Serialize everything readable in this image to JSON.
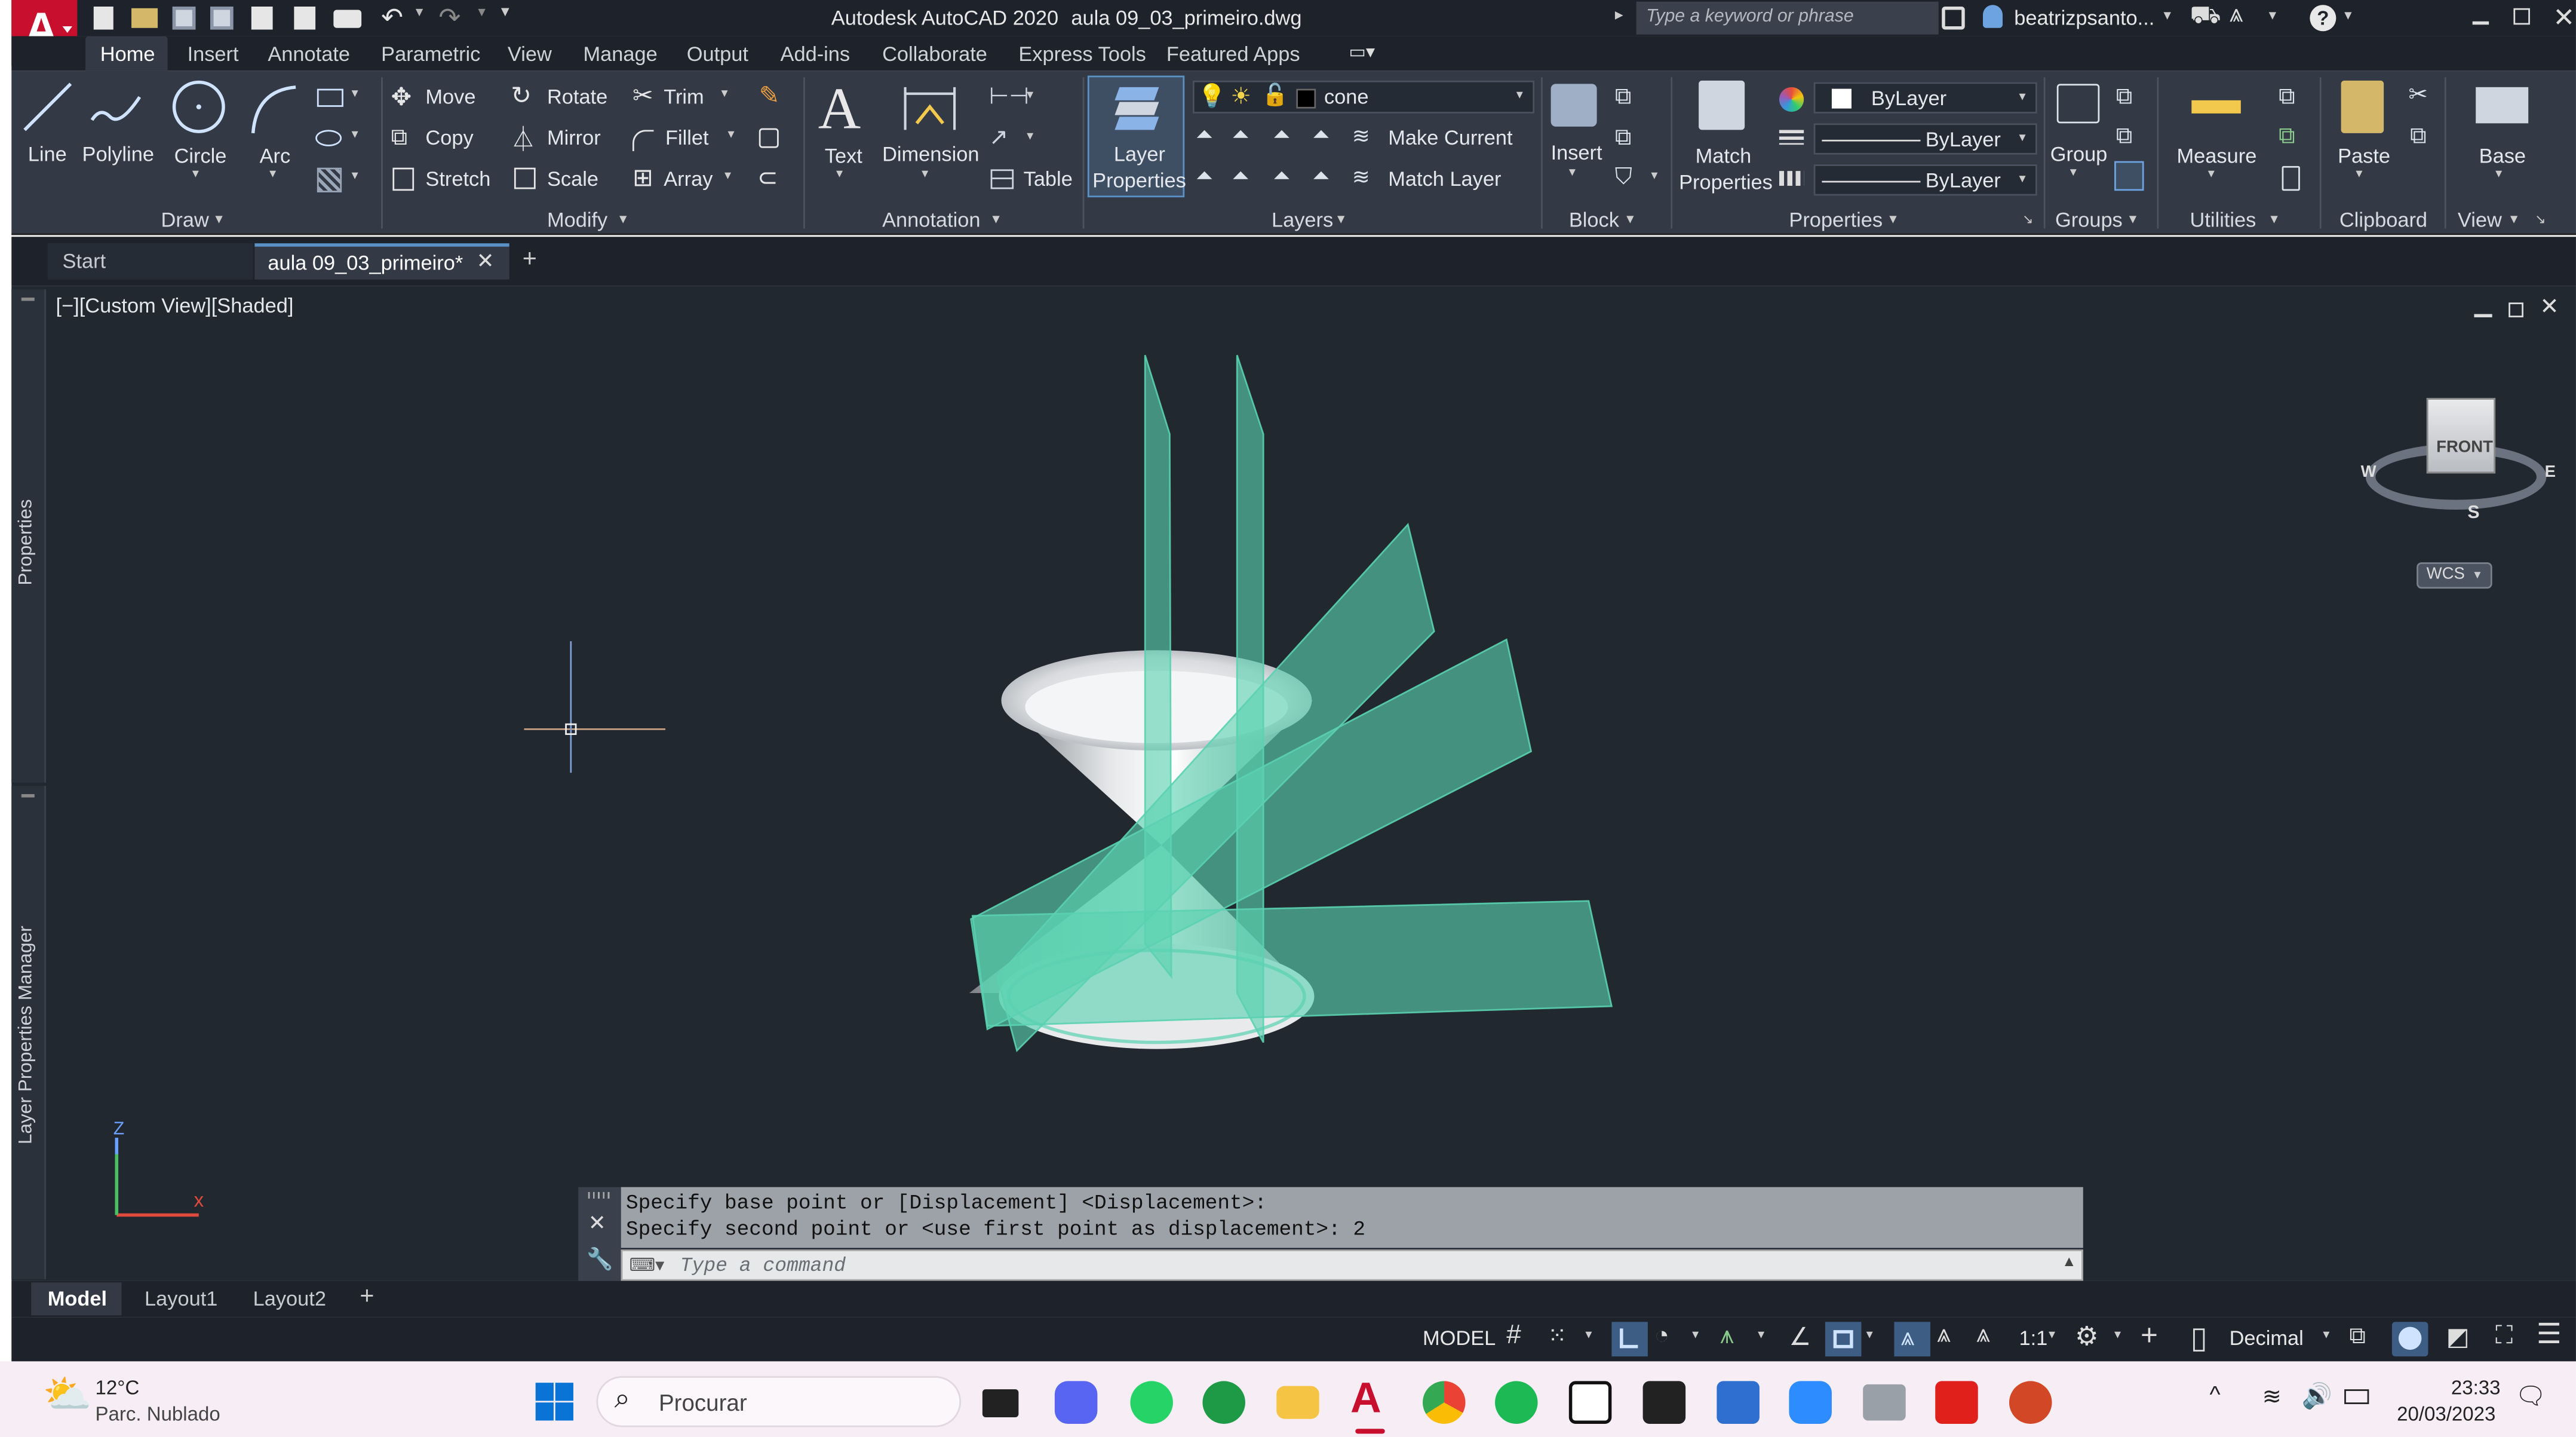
{
  "titlebar": {
    "app_title": "Autodesk AutoCAD 2020",
    "doc_title": "aula 09_03_primeiro.dwg",
    "search_placeholder": "Type a keyword or phrase",
    "user": "beatrizpsanto..."
  },
  "ribbon_tabs": [
    "Home",
    "Insert",
    "Annotate",
    "Parametric",
    "View",
    "Manage",
    "Output",
    "Add-ins",
    "Collaborate",
    "Express Tools",
    "Featured Apps"
  ],
  "draw": {
    "line": "Line",
    "polyline": "Polyline",
    "circle": "Circle",
    "arc": "Arc",
    "title": "Draw"
  },
  "modify": {
    "move": "Move",
    "rotate": "Rotate",
    "trim": "Trim",
    "copy": "Copy",
    "mirror": "Mirror",
    "fillet": "Fillet",
    "stretch": "Stretch",
    "scale": "Scale",
    "array": "Array",
    "title": "Modify"
  },
  "annotation": {
    "text": "Text",
    "dimension": "Dimension",
    "table": "Table",
    "title": "Annotation"
  },
  "layers": {
    "layer_props_1": "Layer",
    "layer_props_2": "Properties",
    "current_layer": "cone",
    "make_current": "Make Current",
    "match_layer": "Match Layer",
    "title": "Layers"
  },
  "block": {
    "insert": "Insert",
    "title": "Block"
  },
  "properties": {
    "match_1": "Match",
    "match_2": "Properties",
    "color": "ByLayer",
    "linetype": "ByLayer",
    "lineweight": "ByLayer",
    "title": "Properties"
  },
  "groups": {
    "group": "Group",
    "title": "Groups"
  },
  "utilities": {
    "measure": "Measure",
    "title": "Utilities"
  },
  "clipboard": {
    "paste": "Paste",
    "title": "Clipboard"
  },
  "view": {
    "base": "Base",
    "title": "View"
  },
  "file_tabs": {
    "start": "Start",
    "doc": "aula 09_03_primeiro*"
  },
  "viewport": {
    "label": "[−][Custom View][Shaded]",
    "viewcube_face": "FRONT",
    "compass_w": "W",
    "compass_e": "E",
    "compass_s": "S",
    "wcs": "WCS",
    "side_properties": "Properties",
    "side_layer_manager": "Layer Properties Manager"
  },
  "command": {
    "line1": "Specify base point or [Displacement] <Displacement>:",
    "line2": "Specify second point or <use first point as displacement>: 2",
    "placeholder": "Type a command"
  },
  "layout_tabs": [
    "Model",
    "Layout1",
    "Layout2"
  ],
  "status": {
    "model": "MODEL",
    "scale": "1:1",
    "units": "Decimal"
  },
  "taskbar": {
    "temp": "12°C",
    "weather": "Parc. Nublado",
    "search": "Procurar",
    "time": "23:33",
    "date": "20/03/2023"
  },
  "colors": {
    "accent": "#5ad2b0",
    "ribbon": "#333a46",
    "dark": "#1e232b",
    "viewport": "#212830"
  }
}
